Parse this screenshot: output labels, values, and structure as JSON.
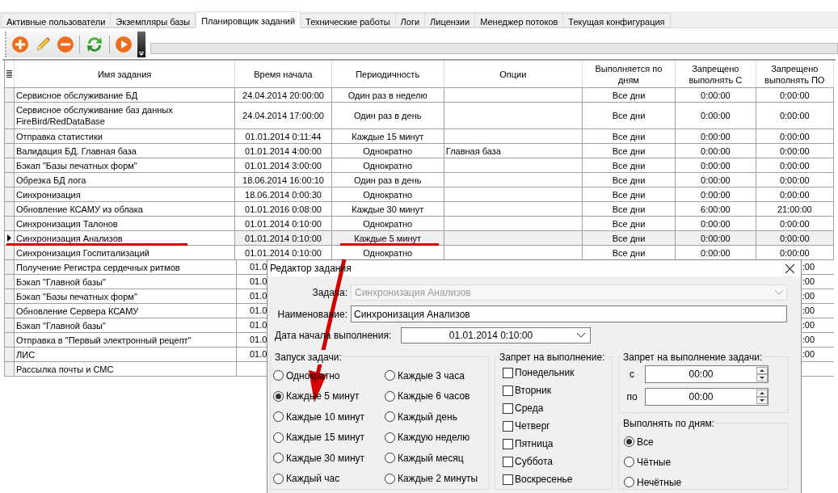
{
  "tabs": [
    {
      "label": "Активные пользователи",
      "selected": false
    },
    {
      "label": "Экземпляры базы",
      "selected": false
    },
    {
      "label": "Планировщик заданий",
      "selected": true
    },
    {
      "label": "Технические работы",
      "selected": false
    },
    {
      "label": "Логи",
      "selected": false
    },
    {
      "label": "Лицензии",
      "selected": false
    },
    {
      "label": "Менеджер потоков",
      "selected": false
    },
    {
      "label": "Текущая конфигурация",
      "selected": false
    }
  ],
  "table": {
    "columns": [
      "Имя задания",
      "Время начала",
      "Периодичность",
      "Опции",
      "Выполняется по дням",
      "Запрещено выполнять С",
      "Запрещено выполнять ПО"
    ],
    "rows": [
      {
        "selected": false,
        "cells": [
          "Сервисное обслуживание БД",
          "24.04.2014 20:00:00",
          "Один раз в неделю",
          "",
          "Все дни",
          "0:00:00",
          "0:00:00"
        ]
      },
      {
        "selected": false,
        "cells": [
          "Сервисное обслуживание баз данных FireBird/RedDataBase",
          "24.04.2014 17:00:00",
          "Один раз в день",
          "",
          "Все дни",
          "0:00:00",
          "0:00:00"
        ]
      },
      {
        "selected": false,
        "cells": [
          "Отправка статистики",
          "01.01.2014 0:11:44",
          "Каждые 15 минут",
          "",
          "Все дни",
          "0:00:00",
          "0:00:00"
        ]
      },
      {
        "selected": false,
        "cells": [
          "Валидация БД. Главная база",
          "01.01.2014 4:00:00",
          "Однократно",
          "Главная база",
          "Все дни",
          "0:00:00",
          "0:00:00"
        ]
      },
      {
        "selected": false,
        "cells": [
          "Бэкап \"Базы печатных форм\"",
          "01.01.2014 3:00:00",
          "Однократно",
          "",
          "Все дни",
          "0:00:00",
          "0:00:00"
        ]
      },
      {
        "selected": false,
        "cells": [
          "Обрезка БД лога",
          "18.06.2014 16:00:10",
          "Один раз в день",
          "",
          "Все дни",
          "0:00:00",
          "0:00:00"
        ]
      },
      {
        "selected": false,
        "cells": [
          "Синхронизация",
          "18.06.2014 0:00:30",
          "Однократно",
          "",
          "Все дни",
          "0:00:00",
          "0:00:00"
        ]
      },
      {
        "selected": false,
        "cells": [
          "Обновление КСАМУ из облака",
          "01.01.2016 0:08:00",
          "Каждые 30 минут",
          "",
          "Все дни",
          "6:00:00",
          "21:00:00"
        ]
      },
      {
        "selected": false,
        "cells": [
          "Синхронизация Талонов",
          "01.01.2014 0:10:00",
          "Однократно",
          "",
          "Все дни",
          "0:00:00",
          "0:00:00"
        ]
      },
      {
        "selected": true,
        "cells": [
          "Синхронизация Анализов",
          "01.01.2014 0:10:00",
          "Каждые 5 минут",
          "",
          "Все дни",
          "0:00:00",
          "0:00:00"
        ]
      },
      {
        "selected": false,
        "cells": [
          "Синхронизация Госпитализаций",
          "01.01.2014 0:10:00",
          "Однократно",
          "",
          "Все дни",
          "0:00:00",
          "0:00:00"
        ]
      },
      {
        "selected": false,
        "cells": [
          "Получение Регистра сердечных ритмов",
          "01.0",
          ":00"
        ]
      },
      {
        "selected": false,
        "cells": [
          "Бэкап \"Главной базы\"",
          "01.0",
          ":00"
        ]
      },
      {
        "selected": false,
        "cells": [
          "Бэкап \"Базы печатных форм\"",
          "01.0",
          ":00"
        ]
      },
      {
        "selected": false,
        "cells": [
          "Обновление Сервера КСАМУ",
          "01.0",
          ":00"
        ]
      },
      {
        "selected": false,
        "cells": [
          "Бэкап \"Главной базы\"",
          "01.0",
          ":00"
        ]
      },
      {
        "selected": false,
        "cells": [
          "Отправка в \"Первый электронный рецепт\"",
          "01.0",
          ":00"
        ]
      },
      {
        "selected": false,
        "cells": [
          "ЛИС",
          "01.0",
          ":00"
        ]
      },
      {
        "selected": false,
        "cells": [
          "Рассылка почты и СМС"
        ]
      }
    ]
  },
  "dialog": {
    "title": "Редактор задания",
    "task": {
      "label": "Задача:",
      "value": "Синхронизация Анализов",
      "disabled": true
    },
    "name": {
      "label": "Наименование:",
      "value": "Синхронизация Анализов"
    },
    "start_date": {
      "label": "Дата начала выполнения:",
      "value": "01.01.2014 0:10:00"
    },
    "launch": {
      "title": "Запуск задачи:",
      "options": [
        {
          "label": "Однократно",
          "selected": false
        },
        {
          "label": "Каждые 5 минут",
          "selected": true
        },
        {
          "label": "Каждые 10 минут",
          "selected": false
        },
        {
          "label": "Каждые 15 минут",
          "selected": false
        },
        {
          "label": "Каждые 30 минут",
          "selected": false
        },
        {
          "label": "Каждый час",
          "selected": false
        },
        {
          "label": "Каждые 3 часа",
          "selected": false
        },
        {
          "label": "Каждые 6 часов",
          "selected": false
        },
        {
          "label": "Каждый день",
          "selected": false
        },
        {
          "label": "Каждую неделю",
          "selected": false
        },
        {
          "label": "Каждый месяц",
          "selected": false
        },
        {
          "label": "Каждые 2 минуты",
          "selected": false
        }
      ]
    },
    "weekday_ban": {
      "title": "Запрет на выполнение:",
      "days": [
        {
          "label": "Понедельник",
          "checked": false
        },
        {
          "label": "Вторник",
          "checked": false
        },
        {
          "label": "Среда",
          "checked": false
        },
        {
          "label": "Четверг",
          "checked": false
        },
        {
          "label": "Пятница",
          "checked": false
        },
        {
          "label": "Суббота",
          "checked": false
        },
        {
          "label": "Воскресенье",
          "checked": false
        }
      ]
    },
    "time_ban": {
      "title": "Запрет на выполнение задачи:",
      "from": {
        "label": "с",
        "value": "00:00"
      },
      "to": {
        "label": "по",
        "value": "00:00"
      }
    },
    "run_days": {
      "title": "Выполнять по дням:",
      "options": [
        {
          "label": "Все",
          "selected": true
        },
        {
          "label": "Чётные",
          "selected": false
        },
        {
          "label": "Нечётные",
          "selected": false
        }
      ]
    }
  }
}
